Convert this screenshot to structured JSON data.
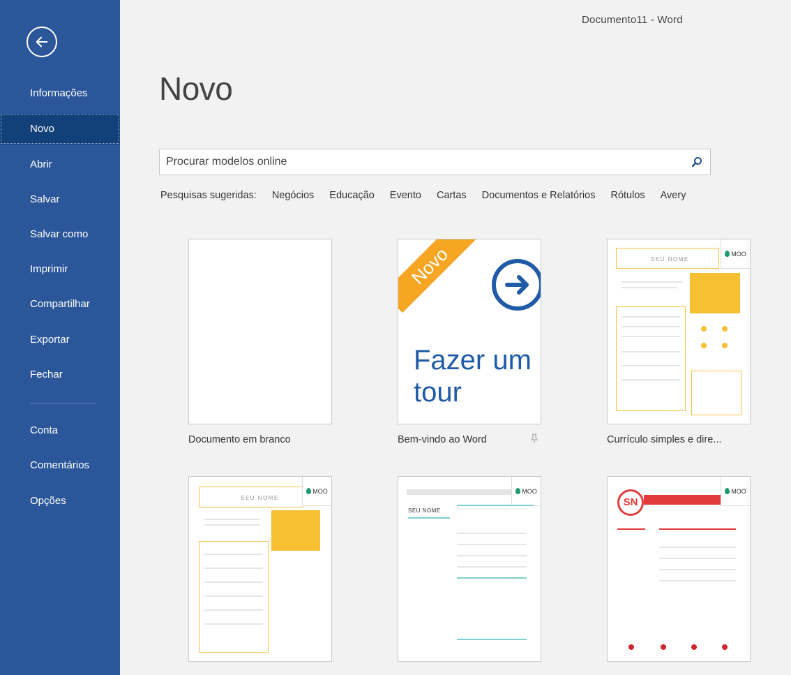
{
  "window_title": "Documento11 - Word",
  "sidebar": {
    "items": [
      {
        "label": "Informações"
      },
      {
        "label": "Novo"
      },
      {
        "label": "Abrir"
      },
      {
        "label": "Salvar"
      },
      {
        "label": "Salvar como"
      },
      {
        "label": "Imprimir"
      },
      {
        "label": "Compartilhar"
      },
      {
        "label": "Exportar"
      },
      {
        "label": "Fechar"
      },
      {
        "label": "Conta"
      },
      {
        "label": "Comentários"
      },
      {
        "label": "Opções"
      }
    ],
    "active_item": "Novo"
  },
  "main": {
    "title": "Novo",
    "search": {
      "placeholder": "Procurar modelos online"
    },
    "suggested": {
      "label": "Pesquisas sugeridas:",
      "links": [
        "Negócios",
        "Educação",
        "Evento",
        "Cartas",
        "Documentos e Relatórios",
        "Rótulos",
        "Avery"
      ]
    },
    "templates": [
      {
        "caption": "Documento em branco"
      },
      {
        "caption": "Bem-vindo ao Word",
        "banner": "Novo",
        "tour_text_1": "Fazer um",
        "tour_text_2": "tour"
      },
      {
        "caption": "Currículo simples e dire...",
        "name": "SEU NOME",
        "brand": "MOO"
      },
      {
        "name": "SEU NOME",
        "brand": "MOO"
      },
      {
        "name": "SEU NOME",
        "brand": "MOO"
      },
      {
        "initials": "SN",
        "brand": "MOO"
      }
    ]
  },
  "colors": {
    "sidebar": "#2b579a",
    "accent_orange": "#f6a623",
    "tour_blue": "#1f5ba7",
    "moo_green": "#1a9a6c"
  }
}
